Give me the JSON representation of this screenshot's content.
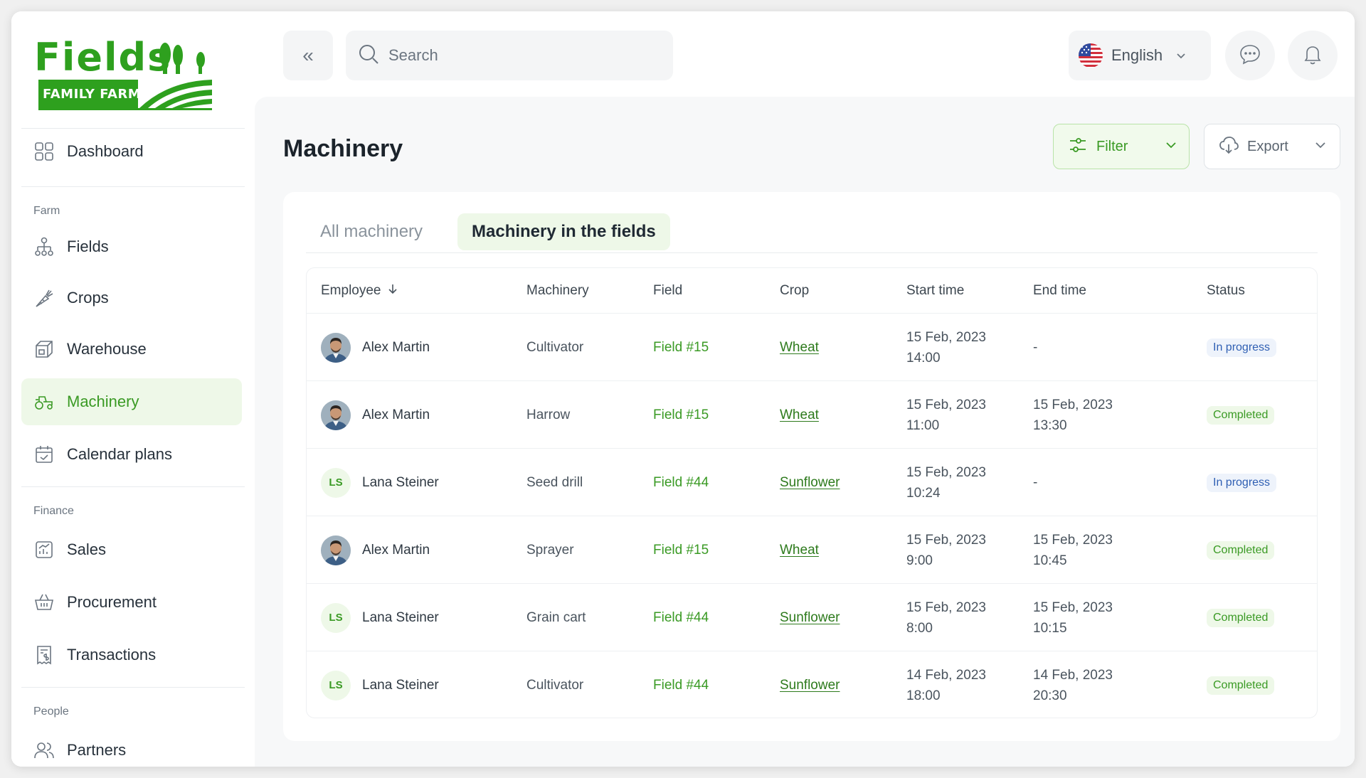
{
  "brand": {
    "name": "Fields",
    "tagline": "FAMILY FARM",
    "color": "#2ea01e"
  },
  "sidebar": {
    "sections": {
      "farm": "Farm",
      "finance": "Finance",
      "people": "People"
    },
    "items": [
      {
        "label": "Dashboard",
        "icon": "grid-icon"
      },
      {
        "label": "Fields",
        "icon": "fields-icon"
      },
      {
        "label": "Crops",
        "icon": "carrot-icon"
      },
      {
        "label": "Warehouse",
        "icon": "box-icon"
      },
      {
        "label": "Machinery",
        "icon": "tractor-icon",
        "active": true
      },
      {
        "label": "Calendar plans",
        "icon": "calendar-icon"
      },
      {
        "label": "Sales",
        "icon": "chart-icon"
      },
      {
        "label": "Procurement",
        "icon": "basket-icon"
      },
      {
        "label": "Transactions",
        "icon": "receipt-icon"
      },
      {
        "label": "Partners",
        "icon": "users-icon"
      }
    ]
  },
  "topbar": {
    "collapse_glyph": "«",
    "search_placeholder": "Search",
    "language": "English"
  },
  "page": {
    "title": "Machinery",
    "filter_label": "Filter",
    "export_label": "Export"
  },
  "tabs": [
    {
      "label": "All machinery",
      "active": false
    },
    {
      "label": "Machinery in the fields",
      "active": true
    }
  ],
  "table": {
    "columns": {
      "employee": "Employee",
      "machinery": "Machinery",
      "field": "Field",
      "crop": "Crop",
      "start": "Start time",
      "end": "End time",
      "status": "Status"
    },
    "rows": [
      {
        "employee": "Alex Martin",
        "avatar": "photo",
        "initials": "",
        "machinery": "Cultivator",
        "field": "Field #15",
        "crop": "Wheat",
        "start_date": "15 Feb, 2023",
        "start_time": "14:00",
        "end_date": "-",
        "end_time": "",
        "status": "In progress"
      },
      {
        "employee": "Alex Martin",
        "avatar": "photo",
        "initials": "",
        "machinery": "Harrow",
        "field": "Field #15",
        "crop": "Wheat",
        "start_date": "15 Feb, 2023",
        "start_time": "11:00",
        "end_date": "15 Feb, 2023",
        "end_time": "13:30",
        "status": "Completed"
      },
      {
        "employee": "Lana Steiner",
        "avatar": "initials",
        "initials": "LS",
        "machinery": "Seed drill",
        "field": "Field #44",
        "crop": "Sunflower",
        "start_date": "15 Feb, 2023",
        "start_time": "10:24",
        "end_date": "-",
        "end_time": "",
        "status": "In progress"
      },
      {
        "employee": "Alex Martin",
        "avatar": "photo",
        "initials": "",
        "machinery": "Sprayer",
        "field": "Field #15",
        "crop": "Wheat",
        "start_date": "15 Feb, 2023",
        "start_time": "9:00",
        "end_date": "15 Feb, 2023",
        "end_time": "10:45",
        "status": "Completed"
      },
      {
        "employee": "Lana Steiner",
        "avatar": "initials",
        "initials": "LS",
        "machinery": "Grain cart",
        "field": "Field #44",
        "crop": "Sunflower",
        "start_date": "15 Feb, 2023",
        "start_time": "8:00",
        "end_date": "15 Feb, 2023",
        "end_time": "10:15",
        "status": "Completed"
      },
      {
        "employee": "Lana Steiner",
        "avatar": "initials",
        "initials": "LS",
        "machinery": "Cultivator",
        "field": "Field #44",
        "crop": "Sunflower",
        "start_date": "14 Feb, 2023",
        "start_time": "18:00",
        "end_date": "14 Feb, 2023",
        "end_time": "20:30",
        "status": "Completed"
      }
    ]
  },
  "colors": {
    "accent": "#3a9a24",
    "accent_bg": "#eef8e8",
    "progress": "#2f5fb3"
  }
}
